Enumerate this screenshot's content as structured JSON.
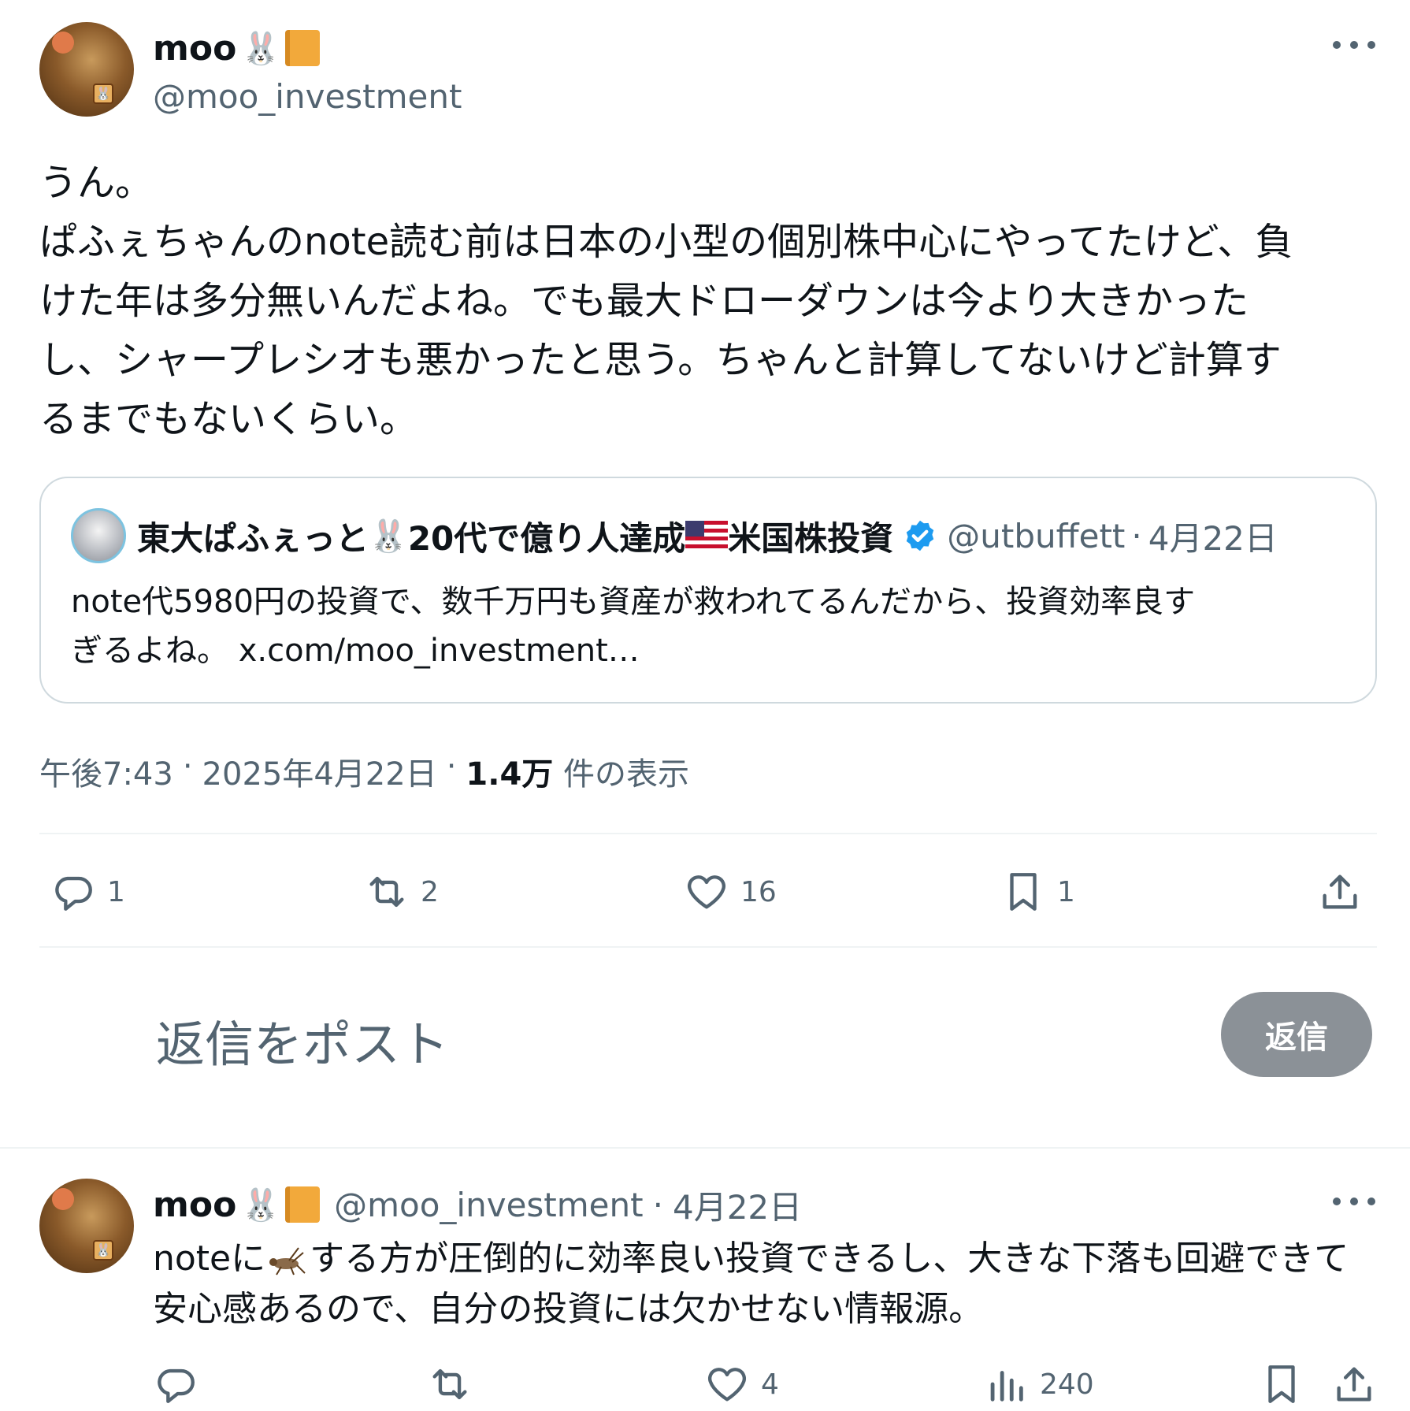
{
  "post": {
    "author_name": "moo",
    "author_emoji_1": "🐰",
    "author_emoji_2_icon": "notebook-icon",
    "handle": "@moo_investment",
    "lines": [
      "うん。",
      "ぱふぇちゃんのnote読む前は日本の小型の個別株中心にやってたけど、負",
      "けた年は多分無いんだよね。でも最大ドローダウンは今より大きかった",
      "し、シャープレシオも悪かったと思う。ちゃんと計算してないけど計算す",
      "るまでもないくらい。"
    ],
    "quote": {
      "name_part1": "東大ぱふぇっと",
      "name_emoji": "🐰",
      "name_part2": "20代で億り人達成",
      "name_part3": "米国株投資",
      "handle": "@utbuffett",
      "sep": "·",
      "date": "4月22日",
      "text_line1": "note代5980円の投資で、数千万円も資産が救われてるんだから、投資効率良す",
      "text_line2": "ぎるよね。 x.com/moo_investment…"
    },
    "meta": {
      "time": "午後7:43",
      "sep1": "·",
      "date": "2025年4月22日",
      "sep2": "·",
      "views_count": "1.4万",
      "views_label": "件の表示"
    },
    "actions": {
      "reply_count": "1",
      "repost_count": "2",
      "like_count": "16",
      "bookmark_count": "1"
    }
  },
  "composer": {
    "placeholder": "返信をポスト",
    "button_label": "返信"
  },
  "reply": {
    "author_name": "moo",
    "author_emoji_1": "🐰",
    "handle": "@moo_investment",
    "sep": "·",
    "date": "4月22日",
    "text_part1": "noteに",
    "text_part2": "する方が圧倒的に効率良い投資できるし、大きな下落も回避できて",
    "text_line2": "安心感あるので、自分の投資には欠かせない情報源。",
    "actions": {
      "like_count": "4",
      "views_count": "240"
    }
  },
  "colors": {
    "text": "#0f1419",
    "secondary": "#536471",
    "border": "#cfd9de",
    "verified": "#1d9bf0",
    "reply_button": "#8b9197"
  }
}
